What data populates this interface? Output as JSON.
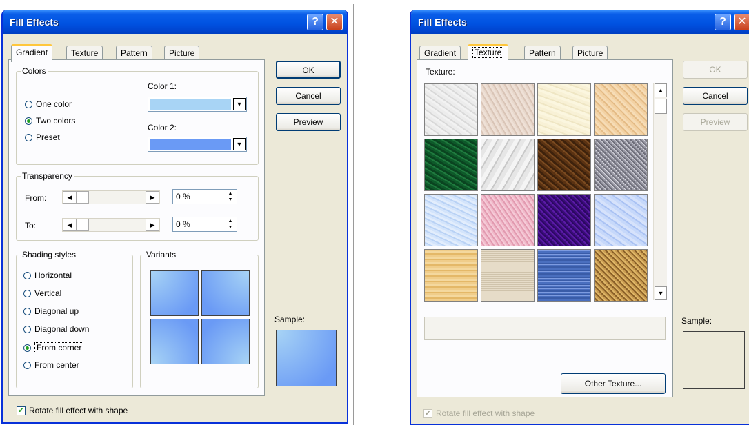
{
  "left_dialog": {
    "title": "Fill Effects",
    "tabs": [
      "Gradient",
      "Texture",
      "Pattern",
      "Picture"
    ],
    "active_tab": "Gradient",
    "colors_group": {
      "legend": "Colors",
      "options": [
        "One color",
        "Two colors",
        "Preset"
      ],
      "selected": "Two colors",
      "color1_label": "Color 1:",
      "color1_value": "#a8d4f5",
      "color2_label": "Color 2:",
      "color2_value": "#6a9af5"
    },
    "transparency_group": {
      "legend": "Transparency",
      "from_label": "From:",
      "from_value": "0 %",
      "to_label": "To:",
      "to_value": "0 %"
    },
    "shading_group": {
      "legend": "Shading styles",
      "options": [
        "Horizontal",
        "Vertical",
        "Diagonal up",
        "Diagonal down",
        "From corner",
        "From center"
      ],
      "selected": "From corner"
    },
    "variants_label": "Variants",
    "buttons": {
      "ok": "OK",
      "cancel": "Cancel",
      "preview": "Preview"
    },
    "sample_label": "Sample:",
    "rotate_label": "Rotate fill effect with shape",
    "rotate_checked": true
  },
  "right_dialog": {
    "title": "Fill Effects",
    "tabs": [
      "Gradient",
      "Texture",
      "Pattern",
      "Picture"
    ],
    "active_tab": "Texture",
    "texture_label": "Texture:",
    "textures": [
      "white-marble",
      "pink-sand",
      "parchment",
      "sand",
      "green-marble",
      "white-marble-2",
      "brown-marble",
      "granite",
      "blue-tissue",
      "pink-tissue",
      "purple-mesh",
      "bouquet",
      "cork-light",
      "woven-mat",
      "denim",
      "canvas"
    ],
    "other_texture_button": "Other Texture...",
    "buttons": {
      "ok": "OK",
      "cancel": "Cancel",
      "preview": "Preview"
    },
    "sample_label": "Sample:",
    "rotate_label": "Rotate fill effect with shape",
    "rotate_checked": true
  },
  "icons": {
    "help": "?",
    "close": "✕",
    "dropdown": "▼",
    "scroll_up": "▲",
    "scroll_down": "▼",
    "left": "◀",
    "right": "▶"
  }
}
